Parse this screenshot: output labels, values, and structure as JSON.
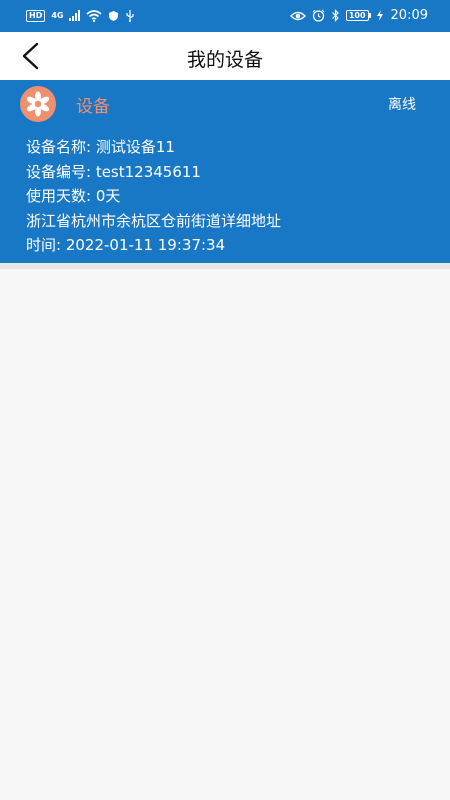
{
  "status_bar": {
    "hd": "HD",
    "network": "4G",
    "battery": "100",
    "time": "20:09"
  },
  "nav": {
    "title": "我的设备"
  },
  "device": {
    "name": "设备",
    "status": "离线",
    "details": {
      "name_line": "设备名称: 测试设备11",
      "code_line": "设备编号: test12345611",
      "days_line": "使用天数: 0天",
      "address_line": "浙江省杭州市余杭区仓前街道详细地址",
      "time_line": "时间: 2022-01-11 19:37:34"
    }
  },
  "colors": {
    "primary": "#1978c6",
    "accent": "#ee8f70",
    "background": "#f7f7f7"
  }
}
